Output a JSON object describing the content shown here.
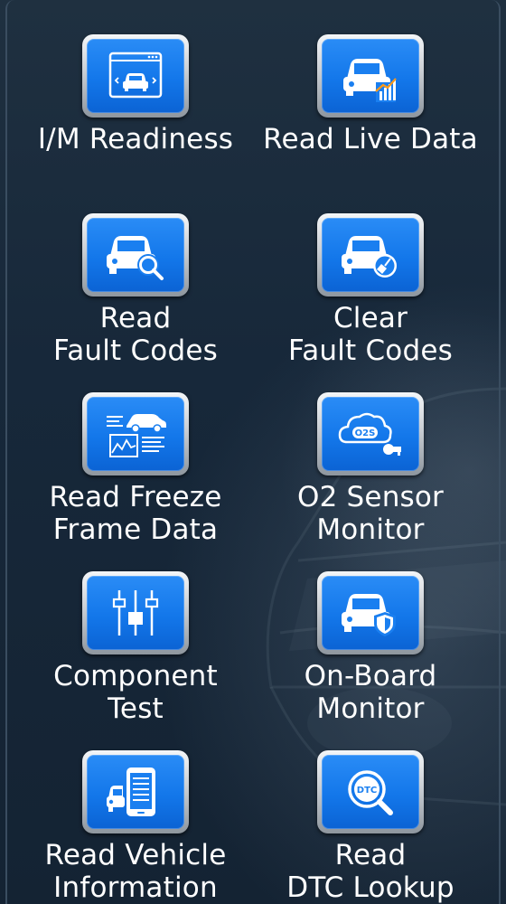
{
  "menu": {
    "items": [
      {
        "id": "im-readiness",
        "icon": "monitor-car-icon",
        "lines": [
          "I/M Readiness",
          ""
        ]
      },
      {
        "id": "read-live-data",
        "icon": "car-chart-icon",
        "lines": [
          "Read Live Data",
          ""
        ]
      },
      {
        "id": "read-fault-codes",
        "icon": "car-search-icon",
        "lines": [
          "Read",
          "Fault Codes"
        ]
      },
      {
        "id": "clear-fault-codes",
        "icon": "car-broom-icon",
        "lines": [
          "Clear",
          "Fault Codes"
        ]
      },
      {
        "id": "read-freeze-frame-data",
        "icon": "freeze-frame-icon",
        "lines": [
          "Read Freeze",
          "Frame Data"
        ]
      },
      {
        "id": "o2-sensor-monitor",
        "icon": "o2s-sensor-icon",
        "icon_text": "O2S",
        "lines": [
          "O2 Sensor",
          "Monitor"
        ]
      },
      {
        "id": "component-test",
        "icon": "sliders-icon",
        "lines": [
          "Component",
          "Test"
        ]
      },
      {
        "id": "on-board-monitor",
        "icon": "car-shield-icon",
        "lines": [
          "On-Board",
          "Monitor"
        ]
      },
      {
        "id": "read-vehicle-information",
        "icon": "car-phone-icon",
        "lines": [
          "Read Vehicle",
          "Information"
        ]
      },
      {
        "id": "read-dtc-lookup",
        "icon": "dtc-search-icon",
        "icon_text": "DTC",
        "lines": [
          "Read",
          "DTC Lookup"
        ]
      }
    ]
  }
}
